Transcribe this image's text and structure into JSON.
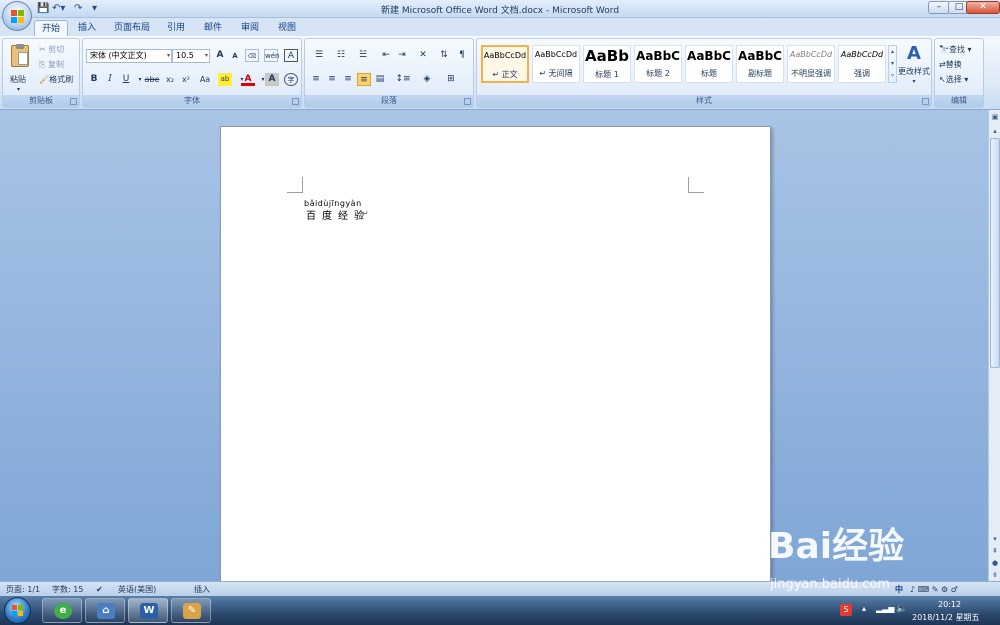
{
  "window": {
    "title": "新建 Microsoft Office Word 文档.docx - Microsoft Word",
    "minimize": "–",
    "maximize": "□",
    "close": "✕"
  },
  "quick_access": {
    "save_icon": "save-icon",
    "undo_icon": "undo-icon",
    "redo_icon": "redo-icon",
    "customize": "▾"
  },
  "tabs": [
    "开始",
    "插入",
    "页面布局",
    "引用",
    "邮件",
    "审阅",
    "视图"
  ],
  "active_tab": "开始",
  "ribbon": {
    "clipboard": {
      "label": "剪贴板",
      "paste": "粘贴",
      "cut": "剪切",
      "copy": "复制",
      "format_painter": "格式刷"
    },
    "font": {
      "label": "字体",
      "font_name": "宋体 (中文正文)",
      "font_size": "10.5",
      "grow": "A",
      "shrink": "A",
      "phonetic": "wén",
      "border_char": "A",
      "bold": "B",
      "italic": "I",
      "underline": "U",
      "strike": "abe",
      "subscript": "x₂",
      "superscript": "x²",
      "change_case": "Aa",
      "highlight": "ab",
      "font_color": "A",
      "char_shading": "A",
      "enclose": "字"
    },
    "paragraph": {
      "label": "段落"
    },
    "styles": {
      "label": "样式",
      "tiles": [
        {
          "sample": "AaBbCcDd",
          "name": "↵ 正文"
        },
        {
          "sample": "AaBbCcDd",
          "name": "↵ 无间隔"
        },
        {
          "sample": "AaBb",
          "name": "标题 1"
        },
        {
          "sample": "AaBbC",
          "name": "标题 2"
        },
        {
          "sample": "AaBbC",
          "name": "标题"
        },
        {
          "sample": "AaBbC",
          "name": "副标题"
        },
        {
          "sample": "AaBbCcDd",
          "name": "不明显强调"
        },
        {
          "sample": "AaBbCcDd",
          "name": "强调"
        }
      ],
      "change_styles": "更改样式"
    },
    "editing": {
      "label": "编辑",
      "find": "查找",
      "replace": "替换",
      "select": "选择"
    }
  },
  "document": {
    "pinyin": "bǎidùjīngyàn",
    "text": "百度经验",
    "paragraph_mark": "↵"
  },
  "statusbar": {
    "page": "页面: 1/1",
    "words": "字数: 15",
    "language": "英语(美国)",
    "insert_mode": "插入"
  },
  "tray": {
    "time": "20:12",
    "date": "2018/11/2 星期五",
    "ime": "中"
  },
  "watermark": {
    "logo": "Bai经验",
    "url": "jingyan.baidu.com"
  },
  "colors": {
    "ribbon_bg": "#dbe8f7",
    "title_text": "#1e395b",
    "accent": "#f2b14d"
  }
}
